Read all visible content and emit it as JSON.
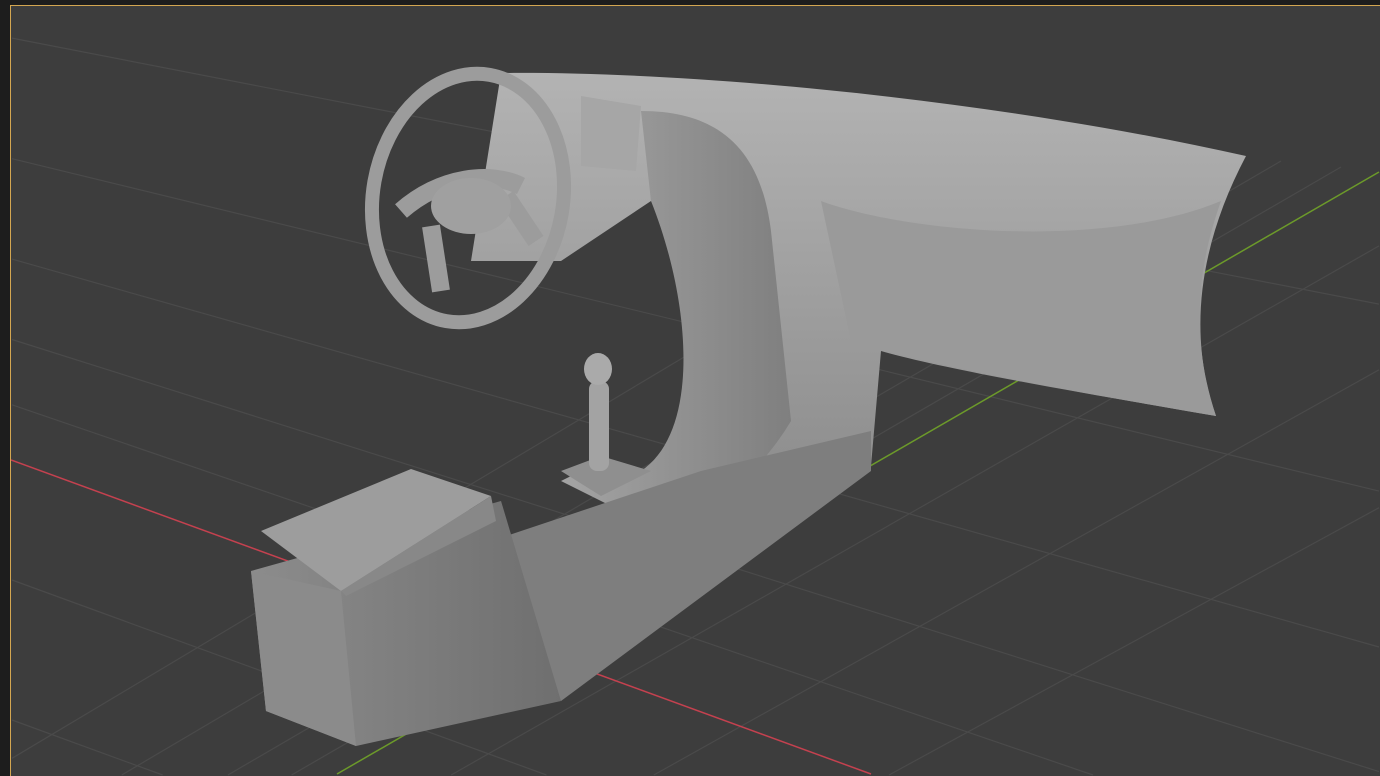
{
  "viewport": {
    "background": "#3d3d3d",
    "active_border": "#d3a651",
    "grid_color": "#4a4a4a",
    "x_axis_color": "#c4414f",
    "y_axis_color": "#6c9a2a"
  },
  "scene": {
    "objects": [
      "dashboard",
      "steering-wheel",
      "center-console",
      "gear-lever",
      "armrest"
    ],
    "model_color": "#9e9e9e"
  }
}
